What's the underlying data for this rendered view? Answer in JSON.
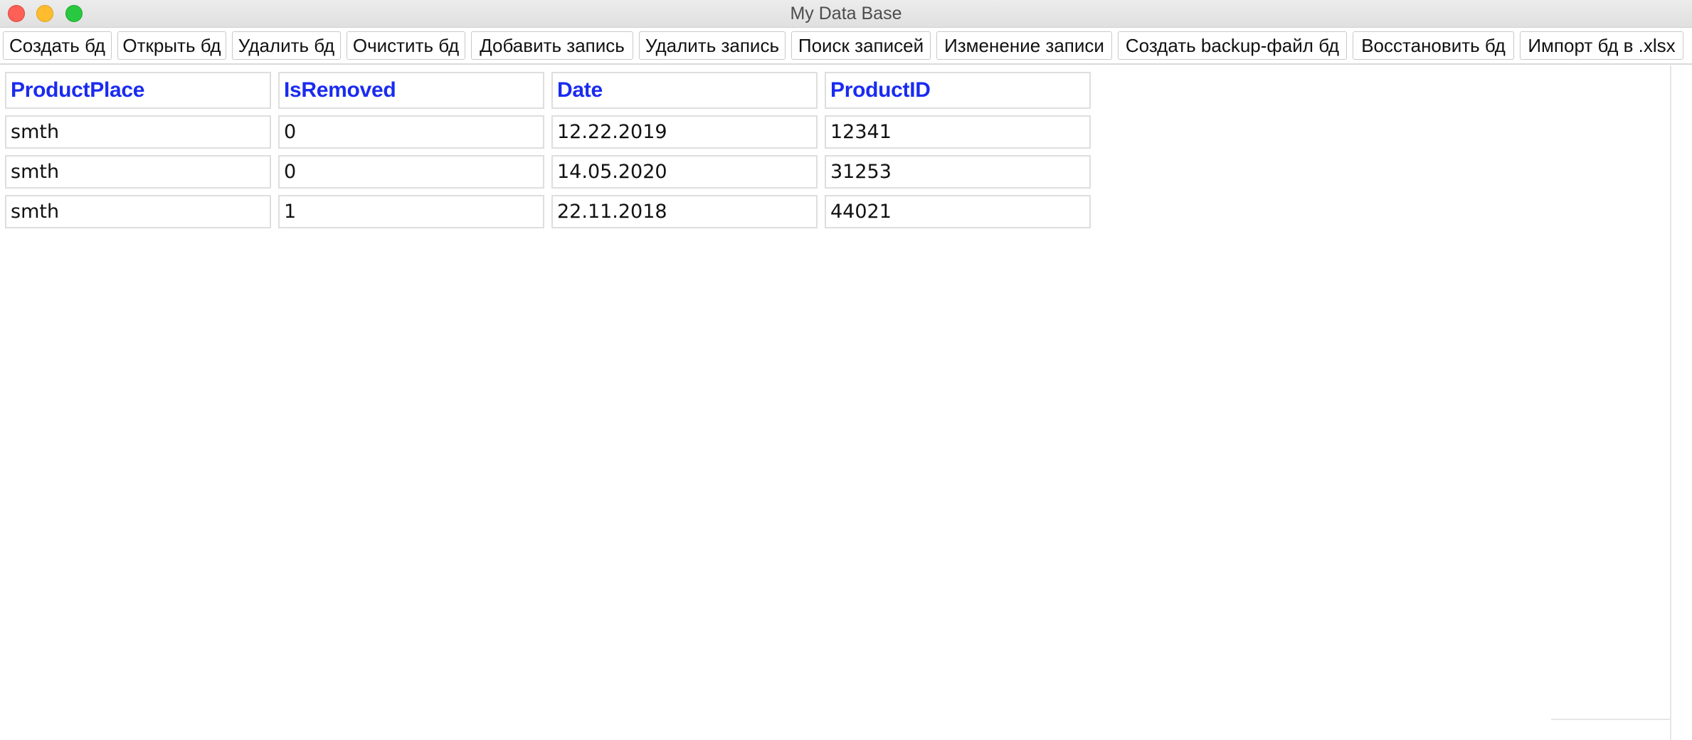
{
  "window": {
    "title": "My Data Base"
  },
  "toolbar": {
    "buttons": [
      {
        "label": "Создать бд"
      },
      {
        "label": "Открыть бд"
      },
      {
        "label": "Удалить бд"
      },
      {
        "label": "Очистить бд"
      },
      {
        "label": "Добавить запись"
      },
      {
        "label": "Удалить запись"
      },
      {
        "label": "Поиск записей"
      },
      {
        "label": "Изменение записи"
      },
      {
        "label": "Создать backup-файл бд"
      },
      {
        "label": "Восстановить бд"
      },
      {
        "label": "Импорт бд в .xlsx"
      }
    ]
  },
  "table": {
    "columns": [
      "ProductPlace",
      "IsRemoved",
      "Date",
      "ProductID"
    ],
    "rows": [
      [
        "smth",
        "0",
        "12.22.2019",
        "12341"
      ],
      [
        "smth",
        "0",
        "14.05.2020",
        "31253"
      ],
      [
        "smth",
        "1",
        "22.11.2018",
        "44021"
      ]
    ]
  },
  "colors": {
    "header_text": "#1a2bf0",
    "close": "#fe5f57",
    "minimize": "#febc2e",
    "maximize": "#28c840"
  }
}
